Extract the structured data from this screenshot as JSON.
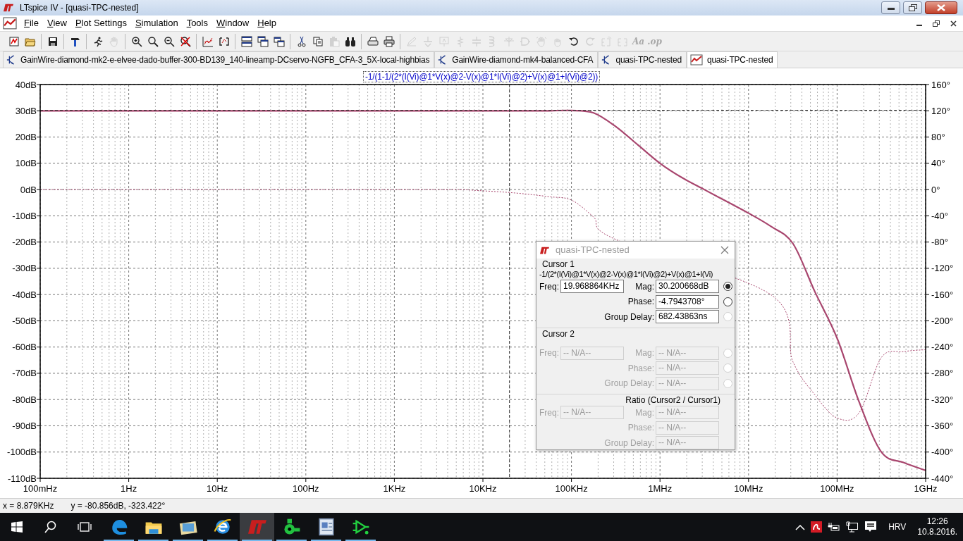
{
  "window": {
    "title": "LTspice IV - [quasi-TPC-nested]"
  },
  "menu": [
    "File",
    "View",
    "Plot Settings",
    "Simulation",
    "Tools",
    "Window",
    "Help"
  ],
  "toolbar": [
    [
      {
        "disabled": false
      },
      {
        "disabled": false
      }
    ],
    [
      {
        "disabled": false
      }
    ],
    [
      {
        "disabled": false
      }
    ],
    [
      {
        "disabled": false
      },
      {
        "disabled": true
      }
    ],
    [
      {
        "disabled": false
      },
      {
        "disabled": false
      },
      {
        "disabled": false
      },
      {
        "disabled": false
      }
    ],
    [
      {
        "disabled": false
      },
      {
        "disabled": false
      }
    ],
    [
      {
        "disabled": false
      },
      {
        "disabled": false
      },
      {
        "disabled": false
      }
    ],
    [
      {
        "disabled": false
      },
      {
        "disabled": false
      },
      {
        "disabled": true
      },
      {
        "disabled": false
      }
    ],
    [
      {
        "disabled": false
      },
      {
        "disabled": false
      }
    ],
    [
      {
        "disabled": true
      },
      {
        "disabled": true
      },
      {
        "disabled": true
      },
      {
        "disabled": true
      },
      {
        "disabled": true
      },
      {
        "disabled": true
      },
      {
        "disabled": true
      },
      {
        "disabled": true
      },
      {
        "disabled": true
      },
      {
        "disabled": true
      },
      {
        "disabled": false
      },
      {
        "disabled": true
      },
      {
        "disabled": true
      },
      {
        "disabled": true
      },
      {
        "disabled": true,
        "label": "Aa"
      },
      {
        "disabled": true,
        "label": ".op"
      }
    ]
  ],
  "tabs": [
    {
      "label": "GainWire-diamond-mk2-e-elvee-dado-buffer-300-BD139_140-lineamp-DCservo-NGFB_CFA-3_5X-local-highbias",
      "kind": "schematic",
      "selected": false
    },
    {
      "label": "GainWire-diamond-mk4-balanced-CFA",
      "kind": "schematic",
      "selected": false
    },
    {
      "label": "quasi-TPC-nested",
      "kind": "schematic",
      "selected": false
    },
    {
      "label": "quasi-TPC-nested",
      "kind": "plot",
      "selected": true
    }
  ],
  "plot": {
    "chart_data": {
      "type": "line",
      "title": "-1/(1-1/(2*(I(Vi)@1*V(x)@2-V(x)@1*I(Vi)@2)+V(x)@1+I(Vi)@2))",
      "categories": [
        "100mHz",
        null,
        null,
        null,
        "1Hz",
        null,
        null,
        null,
        "10Hz",
        null,
        null,
        null,
        "100Hz",
        null,
        null,
        null,
        "1KHz",
        null,
        null,
        null,
        "10KHz",
        null,
        null,
        null,
        "100KHz",
        null,
        null,
        null,
        "1MHz",
        null,
        null,
        null,
        "10MHz",
        null,
        null,
        null,
        "100MHz",
        null,
        null,
        null,
        "1GHz"
      ],
      "series": [
        {
          "color": "#a8466e",
          "values": [
            30,
            30,
            30,
            30,
            30,
            30,
            30,
            30,
            30,
            30,
            30,
            30,
            30,
            30,
            30,
            30,
            30,
            30,
            30,
            30,
            30,
            30,
            30,
            30,
            30.1,
            29.2,
            24,
            17,
            10,
            4.5,
            0,
            -4.5,
            -9,
            -14,
            -20.5,
            -39,
            -56.6,
            -81,
            -100,
            -104,
            -107
          ]
        },
        {
          "color": "#a8466e",
          "axis": "y2",
          "line_style": "dotted",
          "values": [
            0,
            0,
            0,
            0,
            0,
            0,
            0,
            0,
            0,
            0,
            0,
            0,
            0,
            0,
            0,
            0,
            0,
            0,
            0,
            0,
            -2,
            -4,
            -7,
            -11,
            -16,
            -42,
            -76,
            null,
            null,
            null,
            null,
            null,
            null,
            -160,
            -262,
            -313,
            -348,
            -340,
            -256,
            -247,
            -244
          ]
        }
      ],
      "ylim": [
        -110,
        40
      ],
      "grid": true,
      "y2lim": [
        -440,
        160
      ],
      "yticks": [
        {
          "value": 40,
          "label": "40dB"
        },
        {
          "value": 30,
          "label": "30dB"
        },
        {
          "value": 20,
          "label": "20dB"
        },
        {
          "value": 10,
          "label": "10dB"
        },
        {
          "value": 0,
          "label": "0dB"
        },
        {
          "value": -10,
          "label": "-10dB"
        },
        {
          "value": -20,
          "label": "-20dB"
        },
        {
          "value": -30,
          "label": "-30dB"
        },
        {
          "value": -40,
          "label": "-40dB"
        },
        {
          "value": -50,
          "label": "-50dB"
        },
        {
          "value": -60,
          "label": "-60dB"
        },
        {
          "value": -70,
          "label": "-70dB"
        },
        {
          "value": -80,
          "label": "-80dB"
        },
        {
          "value": -90,
          "label": "-90dB"
        },
        {
          "value": -100,
          "label": "-100dB"
        },
        {
          "value": -110,
          "label": "-110dB"
        }
      ],
      "y2ticks": [
        {
          "value": 160,
          "label": "160°"
        },
        {
          "value": 120,
          "label": "120°"
        },
        {
          "value": 80,
          "label": "80°"
        },
        {
          "value": 40,
          "label": "40°"
        },
        {
          "value": 0,
          "label": "0°"
        },
        {
          "value": -40,
          "label": "-40°"
        },
        {
          "value": -80,
          "label": "-80°"
        },
        {
          "value": -120,
          "label": "-120°"
        },
        {
          "value": -160,
          "label": "-160°"
        },
        {
          "value": -200,
          "label": "-200°"
        },
        {
          "value": -240,
          "label": "-240°"
        },
        {
          "value": -280,
          "label": "-280°"
        },
        {
          "value": -320,
          "label": "-320°"
        },
        {
          "value": -360,
          "label": "-360°"
        },
        {
          "value": -400,
          "label": "-400°"
        },
        {
          "value": -440,
          "label": "-440°"
        }
      ],
      "ref_lines": [
        {
          "axis": "y",
          "value": 30.200668
        }
      ]
    }
  },
  "cursor_dialog": {
    "title": "quasi-TPC-nested",
    "sections": [
      {
        "kind": "cursor",
        "legend": "Cursor 1",
        "expression": "-1/(2*(I(Vi)@1*V(x)@2-V(x)@1*I(Vi)@2)+V(x)@1+I(Vi)",
        "disabled": false,
        "freq": {
          "label": "Freq:",
          "value": "19.968864KHz"
        },
        "rows": [
          {
            "label": "Mag:",
            "value": "30.200668dB",
            "radio": {
              "selected": true,
              "disabled": false
            }
          },
          {
            "label": "Phase:",
            "value": "-4.7943708°",
            "radio": {
              "selected": false,
              "disabled": false
            }
          },
          {
            "label": "Group Delay:",
            "value": "682.43863ns",
            "radio": {
              "selected": false,
              "disabled": true
            }
          }
        ]
      },
      {
        "kind": "cursor",
        "legend": "Cursor 2",
        "disabled": true,
        "freq": {
          "label": "Freq:",
          "value": "-- N/A--"
        },
        "rows": [
          {
            "label": "Mag:",
            "value": "-- N/A--",
            "radio": {
              "selected": false,
              "disabled": true
            }
          },
          {
            "label": "Phase:",
            "value": "-- N/A--",
            "radio": {
              "selected": false,
              "disabled": true
            }
          },
          {
            "label": "Group Delay:",
            "value": "-- N/A--",
            "radio": {
              "selected": false,
              "disabled": true
            }
          }
        ]
      },
      {
        "kind": "ratio",
        "legend": "Ratio (Cursor2 / Cursor1)",
        "disabled": true,
        "freq": {
          "label": "Freq:",
          "value": "-- N/A--"
        },
        "rows": [
          {
            "label": "Mag:",
            "value": "-- N/A--"
          },
          {
            "label": "Phase:",
            "value": "-- N/A--"
          },
          {
            "label": "Group Delay:",
            "value": "-- N/A--"
          }
        ]
      }
    ]
  },
  "status_bar": {
    "x": "x = 8.879KHz",
    "y": "y = -80.856dB, -323.422°"
  },
  "taskbar": {
    "apps": [
      {
        "running": true,
        "selected": false
      },
      {
        "running": true,
        "selected": false
      },
      {
        "running": true,
        "selected": false
      },
      {
        "running": true,
        "selected": false
      },
      {
        "running": true,
        "selected": true
      },
      {
        "running": true,
        "selected": false
      },
      {
        "running": true,
        "selected": false
      },
      {
        "running": true,
        "selected": false
      }
    ],
    "language": "HRV",
    "time": "12:26",
    "date": "10.8.2016."
  }
}
